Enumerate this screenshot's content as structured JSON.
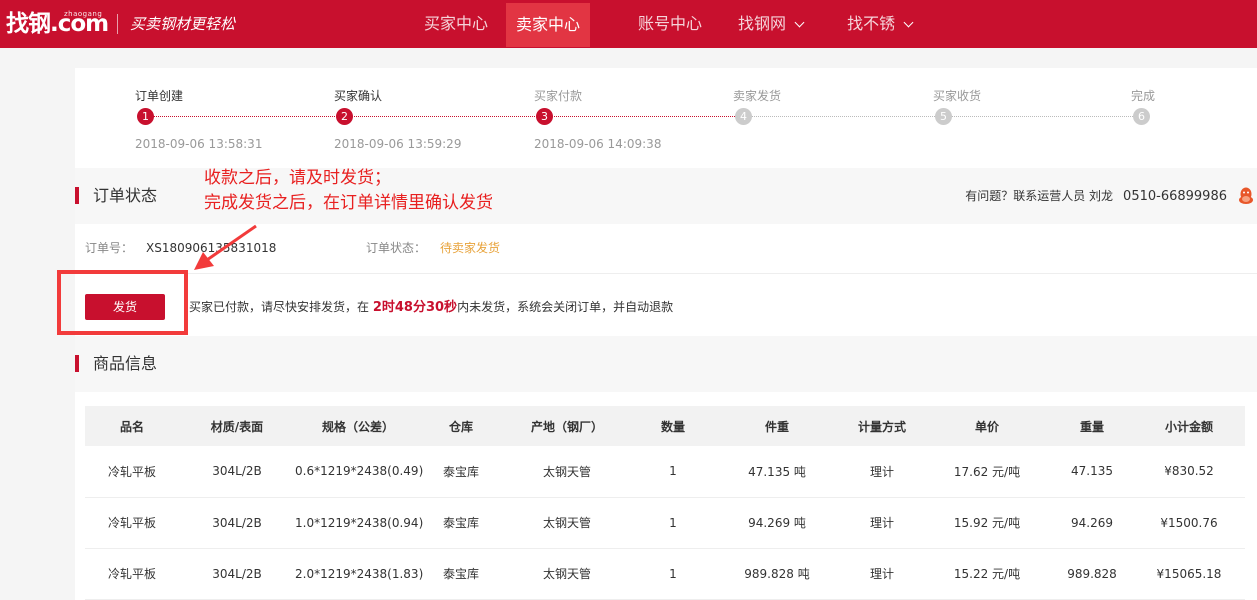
{
  "header": {
    "logo_main": "找钢.com",
    "logo_small": "zhaogang",
    "slogan": "买卖钢材更轻松",
    "nav": [
      {
        "label": "买家中心"
      },
      {
        "label": "卖家中心"
      },
      {
        "label": "账号中心"
      },
      {
        "label": "找钢网"
      },
      {
        "label": "找不锈"
      }
    ]
  },
  "progress": {
    "steps": [
      {
        "label": "订单创建",
        "num": "1",
        "time": "2018-09-06 13:58:31"
      },
      {
        "label": "买家确认",
        "num": "2",
        "time": "2018-09-06 13:59:29"
      },
      {
        "label": "买家付款",
        "num": "3",
        "time": "2018-09-06 14:09:38"
      },
      {
        "label": "卖家发货",
        "num": "4",
        "time": ""
      },
      {
        "label": "买家收货",
        "num": "5",
        "time": ""
      },
      {
        "label": "完成",
        "num": "6",
        "time": ""
      }
    ]
  },
  "order_status": {
    "title": "订单状态",
    "contact_text": "有问题？联系运营人员 刘龙",
    "contact_phone": "0510-66899986",
    "order_no_label": "订单号：",
    "order_no": "XS180906135831018",
    "status_label": "订单状态：",
    "status_value": "待卖家发货",
    "ship_button": "发货",
    "notice_before": "买家已付款，请尽快安排发货，在 ",
    "countdown": "2时48分30秒",
    "notice_after": "内未发货，系统会关闭订单，并自动退款"
  },
  "goods": {
    "title": "商品信息",
    "columns": [
      "品名",
      "材质/表面",
      "规格（公差）",
      "仓库",
      "产地（钢厂）",
      "数量",
      "件重",
      "计量方式",
      "单价",
      "重量",
      "小计金额"
    ],
    "rows": [
      [
        "冷轧平板",
        "304L/2B",
        "0.6*1219*2438(0.49)",
        "泰宝库",
        "太钢天管",
        "1",
        "47.135 吨",
        "理计",
        "17.62 元/吨",
        "47.135",
        "¥830.52"
      ],
      [
        "冷轧平板",
        "304L/2B",
        "1.0*1219*2438(0.94)",
        "泰宝库",
        "太钢天管",
        "1",
        "94.269 吨",
        "理计",
        "15.92 元/吨",
        "94.269",
        "¥1500.76"
      ],
      [
        "冷轧平板",
        "304L/2B",
        "2.0*1219*2438(1.83)",
        "泰宝库",
        "太钢天管",
        "1",
        "989.828 吨",
        "理计",
        "15.22 元/吨",
        "989.828",
        "¥15065.18"
      ]
    ]
  },
  "annotation": {
    "line1": "收款之后，请及时发货；",
    "line2": "完成发货之后，在订单详情里确认发货"
  },
  "colors": {
    "brand_red": "#c8102e",
    "status_orange": "#e8a33b",
    "annotation_red": "#e82020"
  }
}
